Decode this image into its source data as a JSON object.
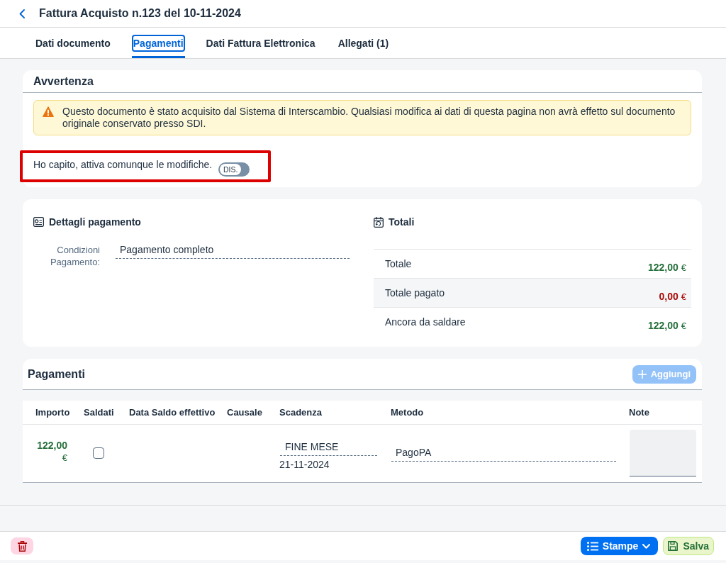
{
  "header": {
    "title": "Fattura Acquisto n.123 del 10-11-2024"
  },
  "tabs": [
    {
      "label": "Dati documento",
      "selected": false
    },
    {
      "label": "Pagamenti",
      "selected": true
    },
    {
      "label": "Dati Fattura Elettronica",
      "selected": false
    },
    {
      "label": "Allegati (1)",
      "selected": false
    }
  ],
  "warning_card": {
    "title": "Avvertenza",
    "message": {
      "kind": "warning",
      "text": "Questo documento è stato acquisito dal Sistema di Interscambio. Qualsiasi modifica ai dati di questa pagina non avrà effetto sul documento originale conservato presso SDI."
    },
    "confirm": {
      "label": "Ho capito, attiva comunque le modifiche.",
      "switch_text": "DIS.",
      "on": false,
      "highlighted": true
    }
  },
  "payment_details": {
    "title": "Dettagli pagamento",
    "fields": [
      {
        "label": "Condizioni Pagamento:",
        "value": "Pagamento completo"
      }
    ]
  },
  "totals": {
    "title": "Totali",
    "rows": [
      {
        "label": "Totale",
        "amount": "122,00",
        "currency": "€",
        "color": "#256f3a"
      },
      {
        "label": "Totale pagato",
        "amount": "0,00",
        "currency": "€",
        "color": "#aa0808"
      },
      {
        "label": "Ancora da saldare",
        "amount": "122,00",
        "currency": "€",
        "color": "#256f3a"
      }
    ]
  },
  "payments": {
    "title": "Pagamenti",
    "add_button": {
      "label": "Aggiungi",
      "disabled": true
    },
    "columns": [
      "Importo",
      "Saldati",
      "Data Saldo effettivo",
      "Causale",
      "Scadenza",
      "Metodo",
      "Note"
    ],
    "rows": [
      {
        "amount": "122,00",
        "currency": "€",
        "settled": false,
        "due_term": "FINE MESE",
        "due_date": "21-11-2024",
        "method": "PagoPA"
      }
    ]
  },
  "footer": {
    "buttons": [
      {
        "kind": "delete"
      },
      {
        "kind": "menu",
        "label": "Stampe"
      },
      {
        "kind": "save",
        "label": "Salva"
      }
    ]
  }
}
